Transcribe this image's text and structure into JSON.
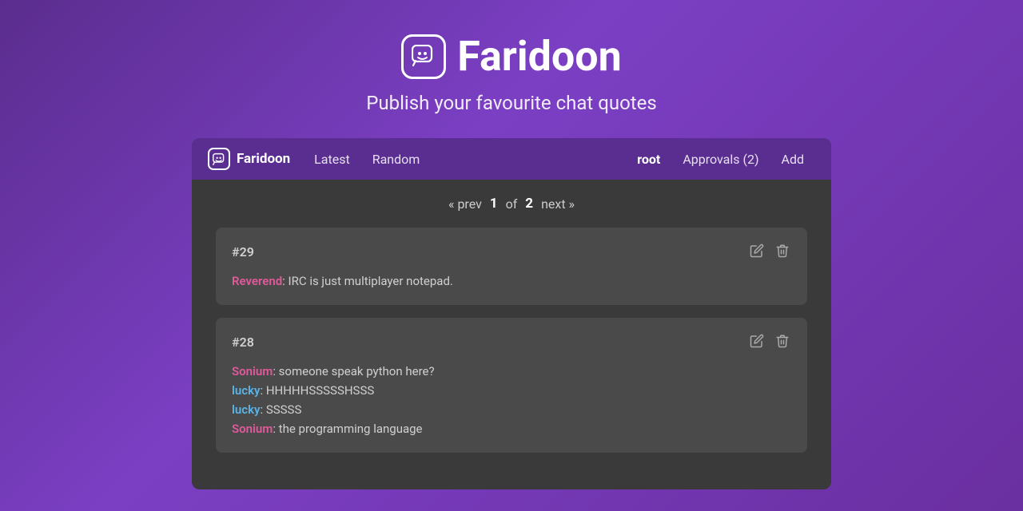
{
  "hero": {
    "app_name": "Faridoon",
    "subtitle": "Publish your favourite chat quotes"
  },
  "navbar": {
    "brand_label": "Faridoon",
    "link_latest": "Latest",
    "link_random": "Random",
    "user_label": "root",
    "approvals_label": "Approvals",
    "approvals_count": "(2)",
    "add_label": "Add"
  },
  "pagination": {
    "prev_label": "« prev",
    "current_page": "1",
    "of_label": "of",
    "total_pages": "2",
    "next_label": "next »"
  },
  "quotes": [
    {
      "id": "#29",
      "lines": [
        {
          "username": "Reverend",
          "username_class": "pink",
          "text": ": IRC is just multiplayer notepad."
        }
      ]
    },
    {
      "id": "#28",
      "lines": [
        {
          "username": "Sonium",
          "username_class": "pink",
          "text": ": someone speak python here?"
        },
        {
          "username": "lucky",
          "username_class": "blue",
          "text": ": HHHHHSSSSSHSSS"
        },
        {
          "username": "lucky",
          "username_class": "blue",
          "text": ": SSSSS"
        },
        {
          "username": "Sonium",
          "username_class": "pink",
          "text": ": the programming language"
        }
      ]
    }
  ],
  "icons": {
    "logo": "🙂",
    "edit": "✏",
    "delete": "🗑"
  }
}
